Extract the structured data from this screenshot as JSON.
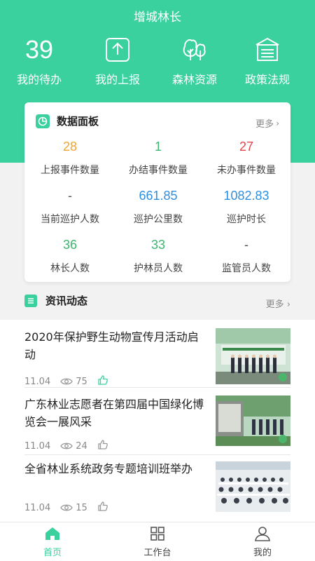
{
  "header": {
    "title": "增城林长",
    "quick": [
      {
        "value": "39",
        "label": "我的待办",
        "icon": "todo-count"
      },
      {
        "label": "我的上报",
        "icon": "upload-icon"
      },
      {
        "label": "森林资源",
        "icon": "tree-icon"
      },
      {
        "label": "政策法规",
        "icon": "document-icon"
      }
    ]
  },
  "dashboard": {
    "title": "数据面板",
    "more": "更多",
    "stats": [
      {
        "value": "28",
        "label": "上报事件数量",
        "color": "#f2a530"
      },
      {
        "value": "1",
        "label": "办结事件数量",
        "color": "#3ab86e"
      },
      {
        "value": "27",
        "label": "未办事件数量",
        "color": "#e6434b"
      },
      {
        "value": "-",
        "label": "当前巡护人数",
        "color": "#555555"
      },
      {
        "value": "661.85",
        "label": "巡护公里数",
        "color": "#2e8fe0"
      },
      {
        "value": "1082.83",
        "label": "巡护时长",
        "color": "#2e8fe0"
      },
      {
        "value": "36",
        "label": "林长人数",
        "color": "#3ab86e"
      },
      {
        "value": "33",
        "label": "护林员人数",
        "color": "#3ab86e"
      },
      {
        "value": "-",
        "label": "监管员人数",
        "color": "#555555"
      }
    ]
  },
  "news": {
    "title": "资讯动态",
    "more": "更多",
    "items": [
      {
        "title": "2020年保护野生动物宣传月活动启动",
        "date": "11.04",
        "views": "75",
        "liked": true
      },
      {
        "title": "广东林业志愿者在第四届中国绿化博览会一展风采",
        "date": "11.04",
        "views": "24",
        "liked": false
      },
      {
        "title": "全省林业系统政务专题培训班举办",
        "date": "11.04",
        "views": "15",
        "liked": false
      }
    ]
  },
  "tabs": [
    {
      "label": "首页",
      "active": true
    },
    {
      "label": "工作台",
      "active": false
    },
    {
      "label": "我的",
      "active": false
    }
  ],
  "colors": {
    "accent": "#3ad19e"
  }
}
